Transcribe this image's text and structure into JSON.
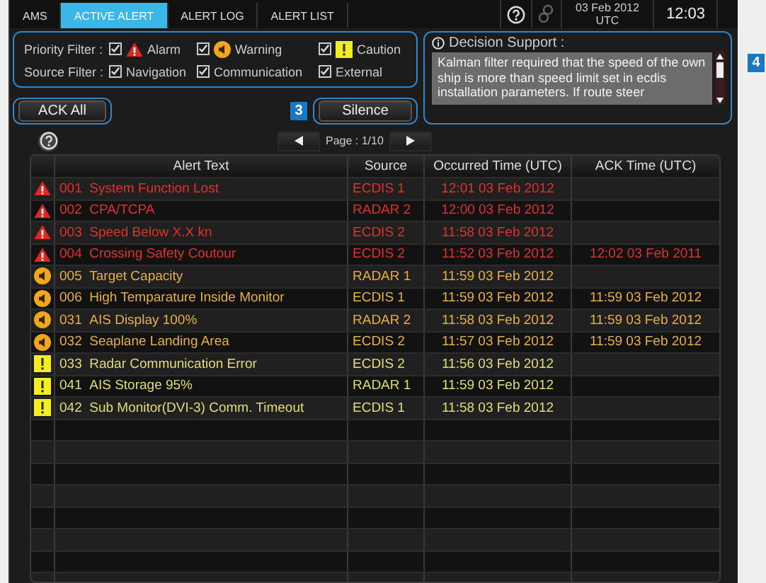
{
  "tabs": [
    {
      "label": "AMS",
      "selected": false
    },
    {
      "label": "ACTIVE ALERT",
      "selected": true
    },
    {
      "label": "ALERT LOG",
      "selected": false
    },
    {
      "label": "ALERT LIST",
      "selected": false
    }
  ],
  "clock": {
    "date": "03 Feb 2012",
    "zone": "UTC",
    "time": "12:03"
  },
  "priority_filter": {
    "label": "Priority Filter :",
    "options": [
      {
        "label": "Alarm",
        "kind": "alarm",
        "checked": true
      },
      {
        "label": "Warning",
        "kind": "warning",
        "checked": true
      },
      {
        "label": "Caution",
        "kind": "caution",
        "checked": true
      }
    ]
  },
  "source_filter": {
    "label": "Source Filter :",
    "options": [
      {
        "label": "Navigation",
        "checked": true
      },
      {
        "label": "Communication",
        "checked": true
      },
      {
        "label": "External",
        "checked": true
      }
    ]
  },
  "ack_all_button": "ACK All",
  "silence_button": "Silence",
  "callouts": [
    "3",
    "4"
  ],
  "decision_support": {
    "title": "Decision Support :",
    "text": "Kalman filter required that the speed of the own ship is more than speed limit set in ecdis installation parameters. If route steer"
  },
  "pager": {
    "text": "Page : 1/10"
  },
  "table": {
    "columns": [
      "Alert Text",
      "Source",
      "Occurred Time (UTC)",
      "ACK Time (UTC)"
    ],
    "rows": [
      {
        "kind": "alarm",
        "number": "001",
        "text": "System Function Lost",
        "source": "ECDIS 1",
        "occurred": "12:01  03 Feb 2012"
      },
      {
        "kind": "alarm",
        "number": "002",
        "text": "CPA/TCPA",
        "source": "RADAR 2",
        "occurred": "12:00  03 Feb 2012"
      },
      {
        "kind": "alarm",
        "number": "003",
        "text": "Speed Below X.X kn",
        "source": "ECDIS 2",
        "occurred": "11:58  03 Feb 2012"
      },
      {
        "kind": "alarm",
        "number": "004",
        "text": "Crossing Safety Coutour",
        "source": "ECDIS 2",
        "occurred": "11:52  03 Feb 2012",
        "ack": "12:02  03 Feb 2011"
      },
      {
        "kind": "warning",
        "number": "005",
        "text": "Target Capacity",
        "source": "RADAR 1",
        "occurred": "11:59  03 Feb 2012"
      },
      {
        "kind": "warning",
        "number": "006",
        "text": "High Temparature Inside Monitor",
        "source": "ECDIS 1",
        "occurred": "11:59  03 Feb 2012",
        "ack": "11:59  03 Feb 2012"
      },
      {
        "kind": "warning",
        "number": "031",
        "text": "AIS Display 100%",
        "source": "RADAR 2",
        "occurred": "11:58  03 Feb 2012",
        "ack": "11:59  03 Feb 2012"
      },
      {
        "kind": "warning",
        "number": "032",
        "text": "Seaplane Landing Area",
        "source": "ECDIS 2",
        "occurred": "11:57  03 Feb 2012",
        "ack": "11:59  03 Feb 2012"
      },
      {
        "kind": "caution",
        "number": "033",
        "text": "Radar Communication Error",
        "source": "ECDIS 2",
        "occurred": "11:56  03 Feb 2012"
      },
      {
        "kind": "caution",
        "number": "041",
        "text": "AIS Storage 95%",
        "source": "RADAR 1",
        "occurred": "11:59  03 Feb 2012"
      },
      {
        "kind": "caution",
        "number": "042",
        "text": "Sub Monitor(DVI-3) Comm. Timeout",
        "source": "ECDIS 1",
        "occurred": "11:58  03 Feb 2012"
      }
    ]
  }
}
